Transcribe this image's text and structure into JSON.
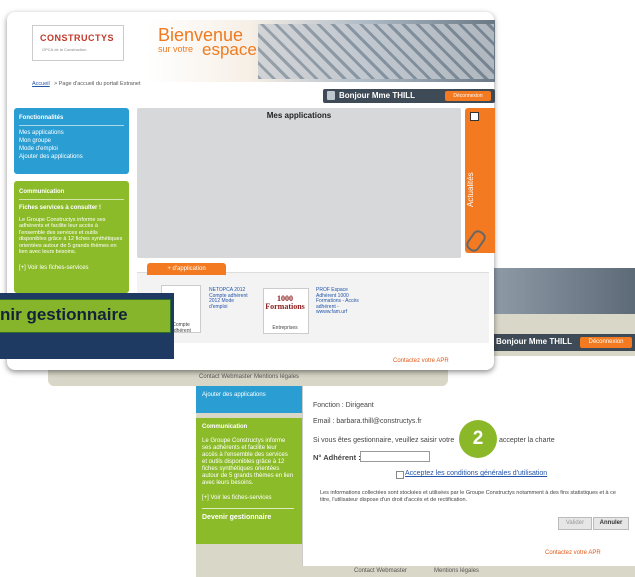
{
  "second_screen": {
    "user_bar": "Bonjour Mme THILL",
    "logout": "Déconnexion",
    "left_blue_item": "Ajouter des applications",
    "green_panel_title": "Communication",
    "green_panel_text": "Le Groupe Constructys informe ses adhérents et facilite leur accès à l'ensemble des services et outils disponibles grâce à 12 fiches synthétiques orientées autour de 5 grands thèmes en lien avec leurs besoins.",
    "green_panel_link": "[+] Voir les fiches-services",
    "devenir_link": "Devenir gestionnaire",
    "form": {
      "fonction": "Fonction : Dirigeant",
      "email": "Email : barbara.thill@constructys.fr",
      "gestionnaire_prompt_start": "Si vous êtes gestionnaire, veuillez saisir votre",
      "gestionnaire_prompt_end": "accepter la charte",
      "adherent_label": "N° Adhérent :",
      "adherent_value": "",
      "conditions_link": "Acceptez les conditions générales d'utilisation",
      "info_text": "Les informations collectées sont stockées et utilisées par le Groupe Constructys notamment à des fins statistiques et à ce titre, l'utilisateur dispose d'un droit d'accès et de rectification.",
      "btn_valider": "Valider",
      "btn_annuler": "Annuler"
    },
    "contact": "Contactez votre APR",
    "footer_contact": "Contact Webmaster",
    "footer_legal": "Mentions légales"
  },
  "step_badge": "2",
  "front_screen": {
    "logo_main": "CONSTRUCTYS",
    "logo_sub": "OPCA de la Construction",
    "banner_line1": "Bienvenue",
    "banner_line2": "sur votre",
    "banner_line3": "espace",
    "breadcrumb_link": "Accueil",
    "breadcrumb_rest": "> Page d'accueil du portail Extranet",
    "user_bar": "Bonjour Mme THILL",
    "logout": "Déconnexion",
    "functions_title": "Fonctionnalités",
    "functions_items": [
      "Mes applications",
      "Mon groupe",
      "Mode d'emploi",
      "Ajouter des applications"
    ],
    "communication_title": "Communication",
    "communication_subtitle": "Fiches services à consulter !",
    "communication_text": "Le Groupe Constructys informe ses adhérents et facilite leur accès à l'ensemble des services et outils disponibles grâce à 12 fiches synthétiques orientées autour de 5 grands thèmes en lien avec leurs besoins.",
    "communication_link": "[+] Voir les fiches-services",
    "apps_title": "Mes applications",
    "actualites": "Actualités",
    "add_app_button": "+ d'application",
    "tile1_caption": "Compte adhérent",
    "tile2_line1": "1000",
    "tile2_line2": "Formations",
    "tile2_caption": "Entreprises",
    "tile3_text": "NETOPCA 2012 Compte adhérent 2012 Mode d'emploi",
    "tile4_text": "PROF Espace Adhérent 1000 Formations - Accès adhérent - wwww.fam.urf",
    "contact": "Contactez votre APR",
    "footer_contact": "Contact Webmaster",
    "footer_legal": "Mentions légales"
  },
  "callout_button": "nir gestionnaire",
  "colors": {
    "orange": "#f37a21",
    "blue": "#2a9ed3",
    "green": "#8cbb29",
    "dark_bar": "#3e4a56",
    "callout_bg": "#1e3a62"
  }
}
